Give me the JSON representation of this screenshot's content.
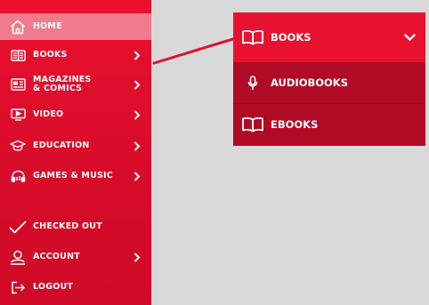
{
  "sidebar": {
    "items": [
      {
        "label": "HOME",
        "icon": "home-icon"
      },
      {
        "label": "BOOKS",
        "icon": "book-grid-icon"
      },
      {
        "label_line1": "MAGAZINES",
        "label_line2": "& COMICS",
        "icon": "magazine-icon"
      },
      {
        "label": "VIDEO",
        "icon": "video-icon"
      },
      {
        "label": "EDUCATION",
        "icon": "graduation-cap-icon"
      },
      {
        "label": "GAMES & MUSIC",
        "icon": "headphones-icon"
      },
      {
        "label": "CHECKED OUT",
        "icon": "checkmark-icon"
      },
      {
        "label": "ACCOUNT",
        "icon": "user-icon"
      },
      {
        "label": "LOGOUT",
        "icon": "logout-icon"
      }
    ]
  },
  "submenu": {
    "header": {
      "label": "BOOKS",
      "icon": "open-book-icon"
    },
    "items": [
      {
        "label": "AUDIOBOOKS",
        "icon": "microphone-icon"
      },
      {
        "label": "EBOOKS",
        "icon": "open-book-icon"
      }
    ]
  },
  "colors": {
    "sidebar_bg": "#e8102e",
    "active_bg": "#f07b8d",
    "submenu_header_bg": "#e8112f",
    "submenu_bg": "#b10a26",
    "page_bg": "#d9d9d9",
    "connector": "#e0101f"
  }
}
